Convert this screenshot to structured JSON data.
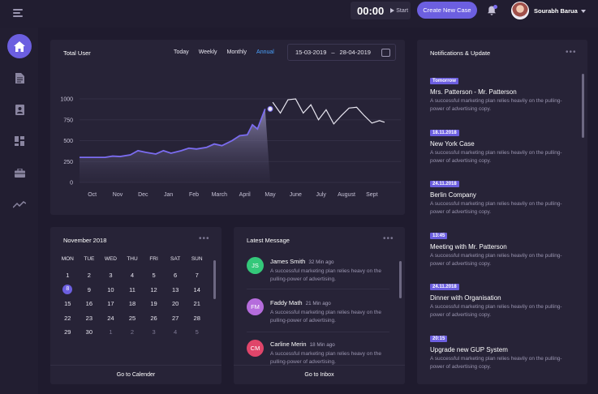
{
  "topbar": {
    "timer": "00:00",
    "start_label": "Start",
    "create_button": "Create New Case",
    "user_name": "Sourabh Barua"
  },
  "sidebar": {
    "items": [
      {
        "icon": "home-icon",
        "active": true
      },
      {
        "icon": "document-icon"
      },
      {
        "icon": "contact-icon"
      },
      {
        "icon": "dashboard-icon"
      },
      {
        "icon": "briefcase-icon"
      },
      {
        "icon": "trend-icon"
      }
    ]
  },
  "chart_panel": {
    "title": "Total User",
    "ranges": [
      "Today",
      "Weekly",
      "Monthly",
      "Annual"
    ],
    "active_range": "Annual",
    "date_from": "15-03-2019",
    "date_sep": "–",
    "date_to": "28-04-2019"
  },
  "chart_data": {
    "type": "area",
    "title": "Total User",
    "categories": [
      "Oct",
      "Nov",
      "Dec",
      "Jan",
      "Feb",
      "March",
      "April",
      "May",
      "June",
      "July",
      "August",
      "Sept"
    ],
    "ylim": [
      0,
      1000
    ],
    "yticks": [
      0,
      250,
      500,
      750,
      1000
    ],
    "highlight_range_end_x": 7.5,
    "x": [
      0,
      0.5,
      1,
      1.3,
      1.6,
      2,
      2.3,
      2.6,
      3,
      3.3,
      3.6,
      4,
      4.3,
      4.6,
      5,
      5.3,
      5.6,
      6,
      6.3,
      6.6,
      6.8,
      7,
      7.3,
      7.6,
      7.9,
      8.2,
      8.5,
      8.8,
      9.1,
      9.4,
      9.7,
      10,
      10.3,
      10.6,
      10.9,
      11.2,
      11.5,
      11.8,
      12
    ],
    "y": [
      300,
      300,
      300,
      315,
      310,
      330,
      380,
      360,
      340,
      380,
      350,
      380,
      410,
      400,
      420,
      460,
      440,
      500,
      560,
      570,
      690,
      640,
      880,
      960,
      830,
      990,
      1000,
      830,
      930,
      750,
      870,
      700,
      800,
      890,
      900,
      800,
      710,
      740,
      720
    ],
    "highlight_point": {
      "x": 7.5,
      "y": 880
    }
  },
  "calendar": {
    "title": "November 2018",
    "weekdays": [
      "MON",
      "TUE",
      "WED",
      "THU",
      "FRI",
      "SAT",
      "SUN"
    ],
    "weeks": [
      [
        "1",
        "2",
        "3",
        "4",
        "5",
        "6",
        "7"
      ],
      [
        "8",
        "9",
        "10",
        "11",
        "12",
        "13",
        "14"
      ],
      [
        "15",
        "16",
        "17",
        "18",
        "19",
        "20",
        "21"
      ],
      [
        "22",
        "23",
        "24",
        "25",
        "26",
        "27",
        "28"
      ],
      [
        "29",
        "30",
        "1",
        "2",
        "3",
        "4",
        "5"
      ]
    ],
    "today": "8",
    "footer": "Go to Calender"
  },
  "messages": {
    "title": "Latest Message",
    "items": [
      {
        "initials": "JS",
        "name": "James Smith",
        "time": "32 Min ago",
        "text": "A successful marketing plan relies heavy on the pulling-power of advertising.",
        "color": "#34c87a"
      },
      {
        "initials": "FM",
        "name": "Faddy Math",
        "time": "21 Min ago",
        "text": "A successful marketing plan relies heavy on the pulling-power of advertising.",
        "color": "#b56cdc"
      },
      {
        "initials": "CM",
        "name": "Carline Merin",
        "time": "18 Min ago",
        "text": "A successful marketing plan relies heavy on the pulling-power of advertising.",
        "color": "#e0456a"
      }
    ],
    "footer": "Go to Inbox"
  },
  "notifications": {
    "title": "Notifications & Update",
    "items": [
      {
        "tag": "Tomorrow",
        "title": "Mrs. Patterson - Mr. Patterson",
        "text": "A successful marketing plan relies heavily on the pulling-power of advertising copy."
      },
      {
        "tag": "18.11.2018",
        "title": "New York Case",
        "text": "A successful marketing plan relies heavily on the pulling-power of advertising copy."
      },
      {
        "tag": "24.11.2018",
        "title": "Berlin Company",
        "text": "A successful marketing plan relies heavily on the pulling-power of advertising copy."
      },
      {
        "tag": "13:45",
        "title": "Meeting with Mr. Patterson",
        "text": "A successful marketing plan relies heavily on the pulling-power of advertising copy."
      },
      {
        "tag": "24.11.2018",
        "title": "Dinner with Organisation",
        "text": "A successful marketing plan relies heavily on the pulling-power of advertising copy."
      },
      {
        "tag": "20:15",
        "title": "Upgrade new GUP System",
        "text": "A successful marketing plan relies heavily on the pulling-power of advertising copy."
      }
    ]
  },
  "colors": {
    "accent": "#6c5fe0",
    "link": "#4aa3ff",
    "background": "#1f1b2e",
    "panel": "#272337"
  }
}
